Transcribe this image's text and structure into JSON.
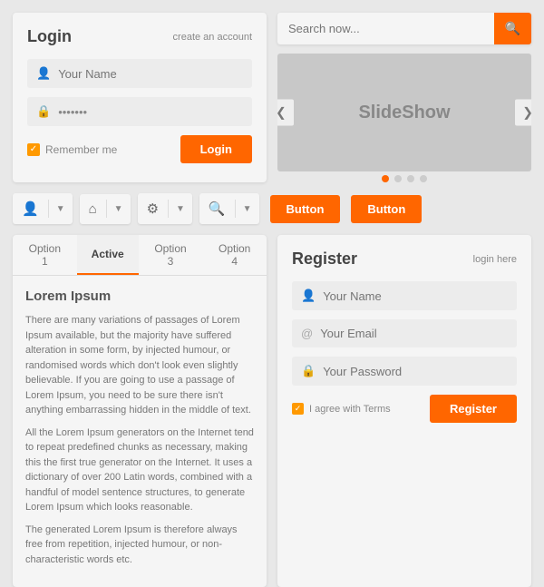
{
  "login": {
    "title": "Login",
    "create_account": "create an account",
    "username_placeholder": "Your Name",
    "password_placeholder": "•••••••",
    "remember_label": "Remember me",
    "login_btn": "Login"
  },
  "search": {
    "placeholder": "Search now..."
  },
  "slideshow": {
    "label": "SlideShow",
    "dots": [
      true,
      false,
      false,
      false
    ]
  },
  "toolbar": {
    "buttons": [
      "Button",
      "Button"
    ]
  },
  "tabs": {
    "items": [
      {
        "label": "Option 1",
        "active": false
      },
      {
        "label": "Active",
        "active": true
      },
      {
        "label": "Option 3",
        "active": false
      },
      {
        "label": "Option 4",
        "active": false
      }
    ],
    "content_title": "Lorem Ipsum",
    "content_paragraphs": [
      "There are many variations of passages of Lorem Ipsum available, but the majority have suffered alteration in some form, by injected humour, or randomised words which don't look even slightly believable. If you are going to use a passage of Lorem Ipsum, you need to be sure there isn't anything embarrassing hidden in the middle of text.",
      "All the Lorem Ipsum generators on the Internet tend to repeat predefined chunks as necessary, making this the first true generator on the Internet. It uses a dictionary of over 200 Latin words, combined with a handful of model sentence structures, to generate Lorem Ipsum which looks reasonable.",
      "The generated Lorem Ipsum is therefore always free from repetition, injected humour, or non-characteristic words etc."
    ]
  },
  "register": {
    "title": "Register",
    "login_here": "login here",
    "name_placeholder": "Your Name",
    "email_placeholder": "Your Email",
    "password_placeholder": "Your Password",
    "agree_label": "I agree with Terms",
    "register_btn": "Register"
  }
}
